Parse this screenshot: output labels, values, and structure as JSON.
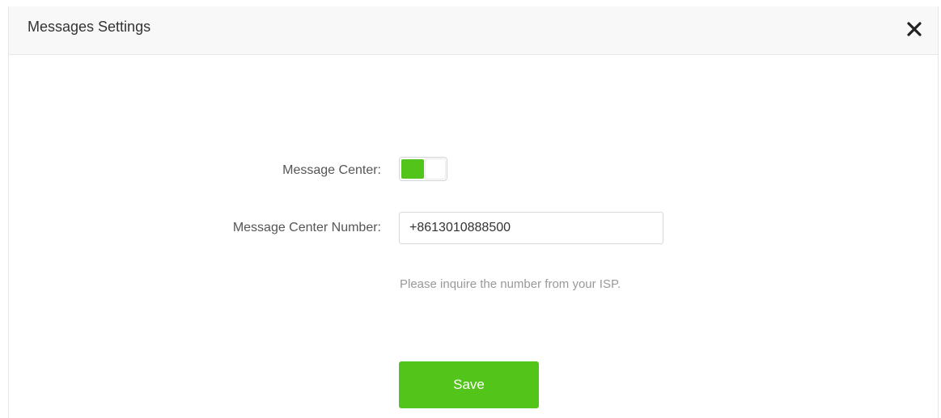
{
  "dialog": {
    "title": "Messages Settings",
    "close_icon": "close-icon"
  },
  "form": {
    "message_center_label": "Message Center:",
    "message_center_enabled": true,
    "message_center_number_label": "Message Center Number:",
    "message_center_number_value": "+8613010888500",
    "hint": "Please inquire the number from your ISP.",
    "save_label": "Save"
  },
  "colors": {
    "accent": "#52c41a",
    "header_bg": "#f8f8f8",
    "label_text": "#555555",
    "hint_text": "#999999"
  }
}
